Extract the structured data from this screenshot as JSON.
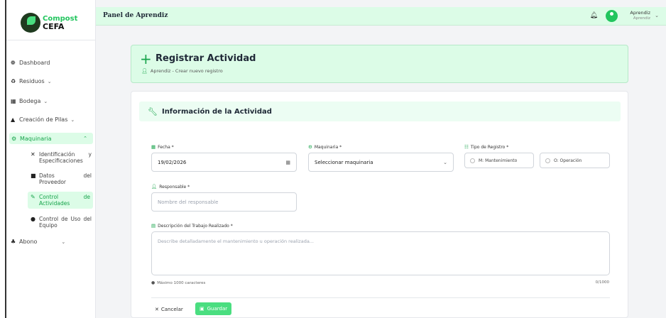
{
  "brand": {
    "line1": "Compost",
    "line2": "CEFA"
  },
  "sidebar": {
    "items": [
      {
        "label": "Dashboard",
        "icon": "palette-icon",
        "chevron": ""
      },
      {
        "label": "Residuos",
        "icon": "recycle-icon",
        "chevron": "⌄"
      },
      {
        "label": "Bodega",
        "icon": "warehouse-icon",
        "chevron": "⌄"
      },
      {
        "label": "Creación de Pilas",
        "icon": "mountain-icon",
        "chevron": "⌄"
      },
      {
        "label": "Maquinaria",
        "icon": "gears-icon",
        "chevron": "⌃"
      },
      {
        "label": "Abono",
        "icon": "seedling-icon",
        "chevron": "⌄"
      }
    ],
    "subitems": [
      {
        "label": "Identificación y Especificaciones",
        "icon": "tools-icon"
      },
      {
        "label": "Datos del Proveedor",
        "icon": "truck-icon"
      },
      {
        "label": "Control de Actividades",
        "icon": "wrench-icon"
      },
      {
        "label": "Control de Uso del Equipo",
        "icon": "gauge-icon"
      }
    ]
  },
  "header": {
    "title": "Panel de Aprendiz",
    "user_name": "Aprendiz",
    "user_role": "Aprendiz"
  },
  "register": {
    "title": "Registrar Actividad",
    "subtitle": "Aprendiz - Crear nuevo registro"
  },
  "form": {
    "section_title": "Información de la Actividad",
    "fecha_label": "Fecha *",
    "fecha_value": "19/02/2026",
    "maquinaria_label": "Maquinaria *",
    "maquinaria_value": "Seleccionar maquinaria",
    "tipo_label": "Tipo de Registro *",
    "tipo_options": [
      "M: Mantenimiento",
      "O: Operación"
    ],
    "responsable_label": "Responsable *",
    "responsable_placeholder": "Nombre del responsable",
    "descripcion_label": "Descripción del Trabajo Realizado *",
    "descripcion_placeholder": "Describe detalladamente el mantenimiento u operación realizada...",
    "hint": "Máximo 1000 caracteres",
    "counter": "0/1000",
    "cancel_label": "Cancelar",
    "save_label": "Guardar"
  }
}
